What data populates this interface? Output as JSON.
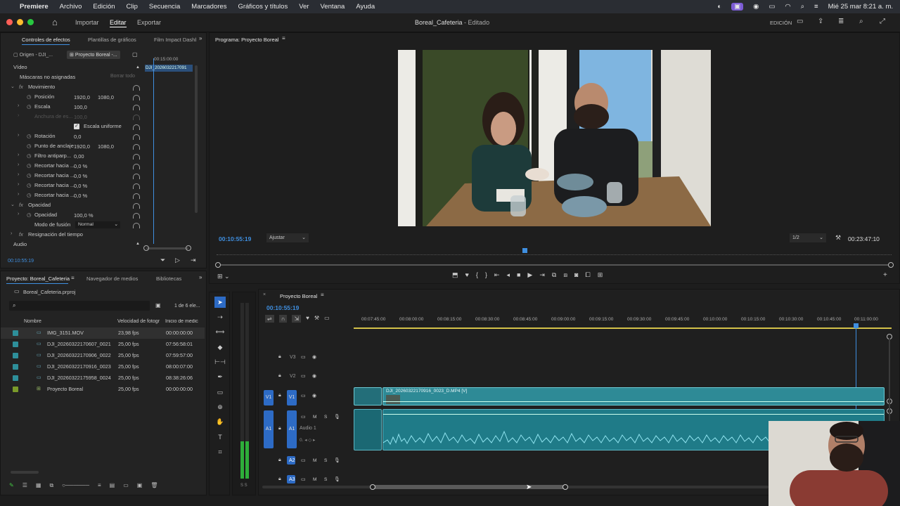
{
  "menubar": {
    "app": "Premiere",
    "items": [
      "Archivo",
      "Edición",
      "Clip",
      "Secuencia",
      "Marcadores",
      "Gráficos y títulos",
      "Ver",
      "Ventana",
      "Ayuda"
    ],
    "datetime": "Mié 25 mar  8:21 a. m."
  },
  "header": {
    "tabs": [
      "Importar",
      "Editar",
      "Exportar"
    ],
    "title": "Boreal_Cafeteria",
    "title_status": " - Editado",
    "workspace": "EDICIÓN"
  },
  "effects": {
    "tabs": [
      "Controles de efectos",
      "Plantillas de gráficos",
      "Film Impact Dashb"
    ],
    "source_tab": "Origen - DJI_...",
    "sequence_tab": "Proyecto Boreal -...",
    "mini_time": "00:15:00:00",
    "clip_label": "DJI_2026032217091",
    "video_label": "Vídeo",
    "masks_label": "Máscaras no asignadas",
    "clear_all": "Borrar todo",
    "movement": "Movimiento",
    "position": {
      "label": "Posición",
      "x": "1920,0",
      "y": "1080,0"
    },
    "scale": {
      "label": "Escala",
      "value": "100,0"
    },
    "scale_width": {
      "label": "Anchura de es...",
      "value": "100,0"
    },
    "uniform": "Escala uniforme",
    "rotation": {
      "label": "Rotación",
      "value": "0,0"
    },
    "anchor": {
      "label": "Punto de anclaje",
      "x": "1920,0",
      "y": "1080,0"
    },
    "flicker": {
      "label": "Filtro antiparp...",
      "value": "0,00"
    },
    "crops": [
      {
        "label": "Recortar hacia ...",
        "value": "0,0 %"
      },
      {
        "label": "Recortar hacia ...",
        "value": "0,0 %"
      },
      {
        "label": "Recortar hacia ...",
        "value": "0,0 %"
      },
      {
        "label": "Recortar hacia ...",
        "value": "0,0 %"
      }
    ],
    "opacity_group": "Opacidad",
    "opacity": {
      "label": "Opacidad",
      "value": "100,0 %"
    },
    "blend": {
      "label": "Modo de fusión",
      "value": "Normal"
    },
    "remap": "Resignación del tiempo",
    "audio_label": "Audio",
    "timecode": "00:10:55:19"
  },
  "program": {
    "title": "Programa: Proyecto Boreal",
    "timecode": "00:10:55:19",
    "fit": "Ajustar",
    "resolution": "1/2",
    "duration": "00:23:47:10"
  },
  "project": {
    "tabs": [
      "Proyecto: Boreal_Cafeteria",
      "Navegador de medios",
      "Bibliotecas"
    ],
    "file": "Boreal_Cafeteria.prproj",
    "count": "1 de 6 ele...",
    "columns": [
      "Nombre",
      "Velocidad de fotogr",
      "Inicio de medic"
    ],
    "items": [
      {
        "name": "IMG_3151.MOV",
        "fps": "23,98 fps",
        "start": "00:00:00:00",
        "color": "#2e8f9a"
      },
      {
        "name": "DJI_20260322170607_0021",
        "fps": "25,00 fps",
        "start": "07:56:58:01",
        "color": "#2e8f9a"
      },
      {
        "name": "DJI_20260322170906_0022",
        "fps": "25,00 fps",
        "start": "07:59:57:00",
        "color": "#2e8f9a"
      },
      {
        "name": "DJI_20260322170916_0023",
        "fps": "25,00 fps",
        "start": "08:00:07:00",
        "color": "#2e8f9a"
      },
      {
        "name": "DJI_20260322175958_0024",
        "fps": "25,00 fps",
        "start": "08:38:26:06",
        "color": "#2e8f9a"
      },
      {
        "name": "Proyecto Boreal",
        "fps": "25,00 fps",
        "start": "00:00:00:00",
        "color": "#7a9a2a"
      }
    ]
  },
  "timeline": {
    "title": "Proyecto Boreal",
    "timecode": "00:10:55:19",
    "ruler": [
      "00:07:45:00",
      "00:08:00:00",
      "00:08:15:00",
      "00:08:30:00",
      "00:08:45:00",
      "00:09:00:00",
      "00:09:15:00",
      "00:09:30:00",
      "00:09:45:00",
      "00:10:00:00",
      "00:10:15:00",
      "00:10:30:00",
      "00:10:45:00",
      "00:11:00:00"
    ],
    "tracks": {
      "v3": "V3",
      "v2": "V2",
      "v1": "V1",
      "a1": "A1",
      "a2": "A2",
      "a3": "A3",
      "audio1": "Audio 1",
      "m": "M",
      "s": "S"
    },
    "clip_name": "DJI_20260322170916_0023_D.MP4 [V]"
  }
}
